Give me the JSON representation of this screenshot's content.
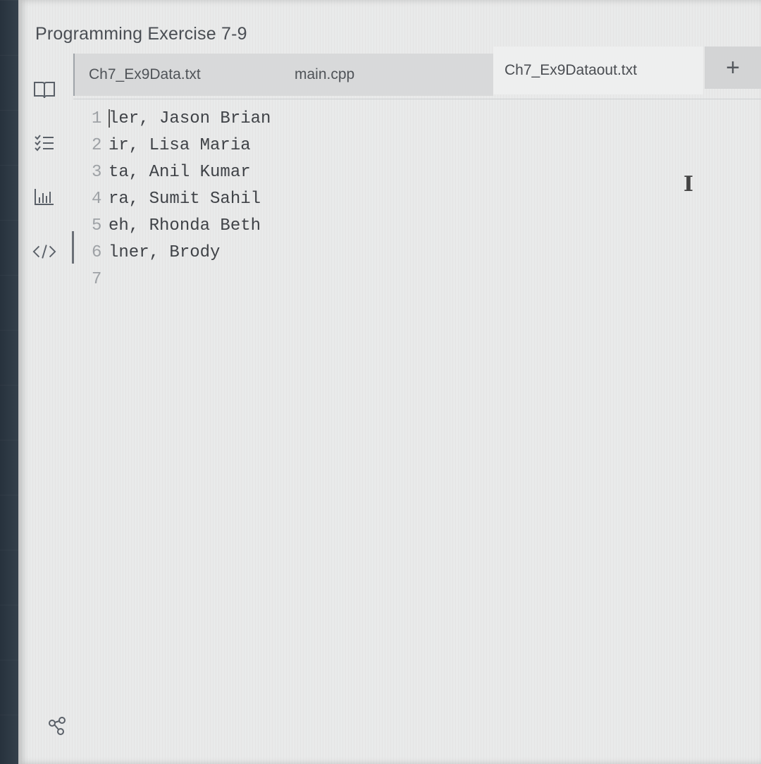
{
  "title": "Programming Exercise 7-9",
  "tabs": [
    {
      "label": "Ch7_Ex9Data.txt"
    },
    {
      "label": "main.cpp"
    },
    {
      "label": "Ch7_Ex9Dataout.txt",
      "active": true
    }
  ],
  "add_tab_label": "+",
  "editor": {
    "lines": [
      {
        "number": "1",
        "text": "ler, Jason Brian"
      },
      {
        "number": "2",
        "text": "ir, Lisa Maria"
      },
      {
        "number": "3",
        "text": "ta, Anil Kumar"
      },
      {
        "number": "4",
        "text": "ra, Sumit Sahil"
      },
      {
        "number": "5",
        "text": "eh, Rhonda Beth"
      },
      {
        "number": "6",
        "text": "lner, Brody"
      },
      {
        "number": "7",
        "text": ""
      }
    ]
  },
  "icons": {
    "rail": [
      "book-icon",
      "checklist-icon",
      "bar-chart-icon",
      "code-icon"
    ],
    "bottom": "share-icon",
    "cursor": "text-cursor-icon"
  },
  "cursor_glyph": "I"
}
